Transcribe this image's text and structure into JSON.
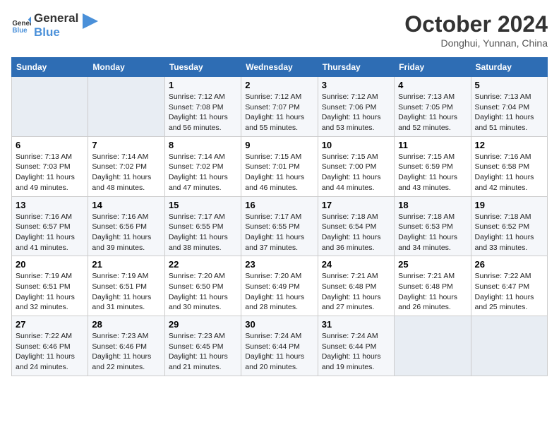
{
  "header": {
    "logo_line1": "General",
    "logo_line2": "Blue",
    "month": "October 2024",
    "location": "Donghui, Yunnan, China"
  },
  "weekdays": [
    "Sunday",
    "Monday",
    "Tuesday",
    "Wednesday",
    "Thursday",
    "Friday",
    "Saturday"
  ],
  "weeks": [
    [
      {
        "day": "",
        "empty": true
      },
      {
        "day": "",
        "empty": true
      },
      {
        "day": "1",
        "sunrise": "7:12 AM",
        "sunset": "7:08 PM",
        "daylight": "11 hours and 56 minutes."
      },
      {
        "day": "2",
        "sunrise": "7:12 AM",
        "sunset": "7:07 PM",
        "daylight": "11 hours and 55 minutes."
      },
      {
        "day": "3",
        "sunrise": "7:12 AM",
        "sunset": "7:06 PM",
        "daylight": "11 hours and 53 minutes."
      },
      {
        "day": "4",
        "sunrise": "7:13 AM",
        "sunset": "7:05 PM",
        "daylight": "11 hours and 52 minutes."
      },
      {
        "day": "5",
        "sunrise": "7:13 AM",
        "sunset": "7:04 PM",
        "daylight": "11 hours and 51 minutes."
      }
    ],
    [
      {
        "day": "6",
        "sunrise": "7:13 AM",
        "sunset": "7:03 PM",
        "daylight": "11 hours and 49 minutes."
      },
      {
        "day": "7",
        "sunrise": "7:14 AM",
        "sunset": "7:02 PM",
        "daylight": "11 hours and 48 minutes."
      },
      {
        "day": "8",
        "sunrise": "7:14 AM",
        "sunset": "7:02 PM",
        "daylight": "11 hours and 47 minutes."
      },
      {
        "day": "9",
        "sunrise": "7:15 AM",
        "sunset": "7:01 PM",
        "daylight": "11 hours and 46 minutes."
      },
      {
        "day": "10",
        "sunrise": "7:15 AM",
        "sunset": "7:00 PM",
        "daylight": "11 hours and 44 minutes."
      },
      {
        "day": "11",
        "sunrise": "7:15 AM",
        "sunset": "6:59 PM",
        "daylight": "11 hours and 43 minutes."
      },
      {
        "day": "12",
        "sunrise": "7:16 AM",
        "sunset": "6:58 PM",
        "daylight": "11 hours and 42 minutes."
      }
    ],
    [
      {
        "day": "13",
        "sunrise": "7:16 AM",
        "sunset": "6:57 PM",
        "daylight": "11 hours and 41 minutes."
      },
      {
        "day": "14",
        "sunrise": "7:16 AM",
        "sunset": "6:56 PM",
        "daylight": "11 hours and 39 minutes."
      },
      {
        "day": "15",
        "sunrise": "7:17 AM",
        "sunset": "6:55 PM",
        "daylight": "11 hours and 38 minutes."
      },
      {
        "day": "16",
        "sunrise": "7:17 AM",
        "sunset": "6:55 PM",
        "daylight": "11 hours and 37 minutes."
      },
      {
        "day": "17",
        "sunrise": "7:18 AM",
        "sunset": "6:54 PM",
        "daylight": "11 hours and 36 minutes."
      },
      {
        "day": "18",
        "sunrise": "7:18 AM",
        "sunset": "6:53 PM",
        "daylight": "11 hours and 34 minutes."
      },
      {
        "day": "19",
        "sunrise": "7:18 AM",
        "sunset": "6:52 PM",
        "daylight": "11 hours and 33 minutes."
      }
    ],
    [
      {
        "day": "20",
        "sunrise": "7:19 AM",
        "sunset": "6:51 PM",
        "daylight": "11 hours and 32 minutes."
      },
      {
        "day": "21",
        "sunrise": "7:19 AM",
        "sunset": "6:51 PM",
        "daylight": "11 hours and 31 minutes."
      },
      {
        "day": "22",
        "sunrise": "7:20 AM",
        "sunset": "6:50 PM",
        "daylight": "11 hours and 30 minutes."
      },
      {
        "day": "23",
        "sunrise": "7:20 AM",
        "sunset": "6:49 PM",
        "daylight": "11 hours and 28 minutes."
      },
      {
        "day": "24",
        "sunrise": "7:21 AM",
        "sunset": "6:48 PM",
        "daylight": "11 hours and 27 minutes."
      },
      {
        "day": "25",
        "sunrise": "7:21 AM",
        "sunset": "6:48 PM",
        "daylight": "11 hours and 26 minutes."
      },
      {
        "day": "26",
        "sunrise": "7:22 AM",
        "sunset": "6:47 PM",
        "daylight": "11 hours and 25 minutes."
      }
    ],
    [
      {
        "day": "27",
        "sunrise": "7:22 AM",
        "sunset": "6:46 PM",
        "daylight": "11 hours and 24 minutes."
      },
      {
        "day": "28",
        "sunrise": "7:23 AM",
        "sunset": "6:46 PM",
        "daylight": "11 hours and 22 minutes."
      },
      {
        "day": "29",
        "sunrise": "7:23 AM",
        "sunset": "6:45 PM",
        "daylight": "11 hours and 21 minutes."
      },
      {
        "day": "30",
        "sunrise": "7:24 AM",
        "sunset": "6:44 PM",
        "daylight": "11 hours and 20 minutes."
      },
      {
        "day": "31",
        "sunrise": "7:24 AM",
        "sunset": "6:44 PM",
        "daylight": "11 hours and 19 minutes."
      },
      {
        "day": "",
        "empty": true
      },
      {
        "day": "",
        "empty": true
      }
    ]
  ],
  "labels": {
    "sunrise": "Sunrise:",
    "sunset": "Sunset:",
    "daylight": "Daylight:"
  }
}
